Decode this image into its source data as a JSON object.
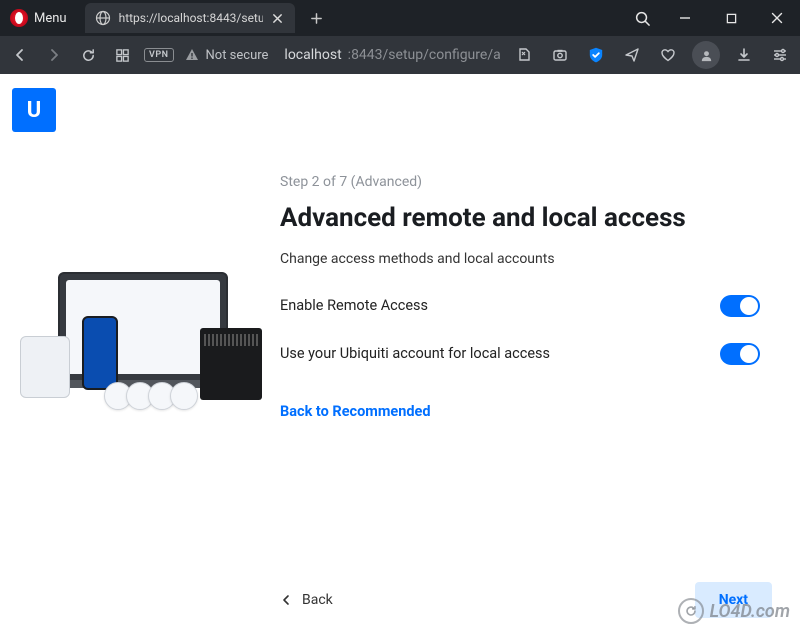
{
  "browser": {
    "menu_label": "Menu",
    "tab_title": "https://localhost:8443/setu",
    "not_secure_label": "Not secure",
    "vpn_label": "VPN",
    "url_host": "localhost",
    "url_port_path": ":8443/setup/configure/a"
  },
  "setup": {
    "step_label": "Step 2 of 7 (Advanced)",
    "heading": "Advanced remote and local access",
    "description": "Change access methods and local accounts",
    "toggle1_label": "Enable Remote Access",
    "toggle1_on": true,
    "toggle2_label": "Use your Ubiquiti account for local access",
    "toggle2_on": true,
    "back_to_recommended": "Back to Recommended",
    "back_label": "Back",
    "next_label": "Next",
    "brand_letter": "U"
  },
  "watermark": {
    "text": "LO4D.com"
  },
  "colors": {
    "accent": "#006fff",
    "chrome_bg": "#1e2227",
    "toolbar_bg": "#31353b"
  }
}
